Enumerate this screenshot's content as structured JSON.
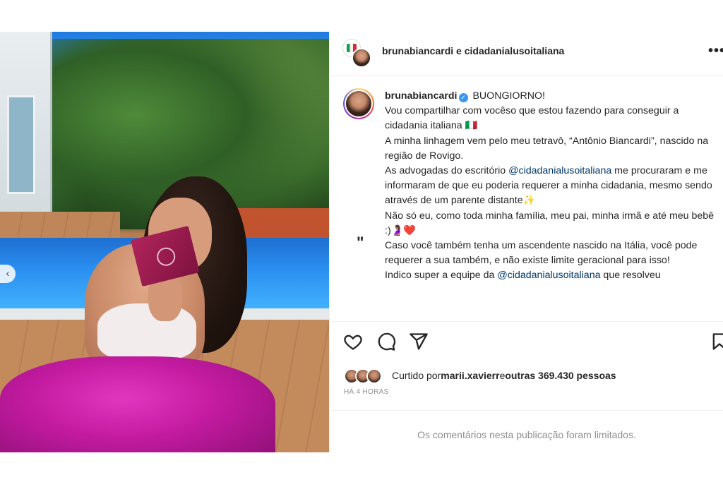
{
  "header": {
    "title_user1": "brunabiancardi",
    "title_conj": " e ",
    "title_user2": "cidadanialusoitaliana",
    "more_icon": "more-horizontal-icon",
    "more_glyph": "•••"
  },
  "post": {
    "carousel_prev_glyph": "‹",
    "carousel_dots": 3,
    "carousel_active": 2
  },
  "caption": {
    "username": "brunabiancardi",
    "verified_glyph": "✓",
    "greeting": "BUONGIORNO!",
    "p1": "Vou compartilhar com vocêso que estou fazendo para conseguir a cidadania italiana 🇮🇹",
    "p2": "A minha linhagem vem pelo meu tetravô, “Antônio Biancardi”, nascido na região de Rovigo.",
    "p3_before": "As advogadas do escritório ",
    "p3_mention": "@cidadanialusoitaliana",
    "p3_after": " me procuraram e me informaram de que eu poderia requerer a minha cidadania, mesmo sendo através de um parente distante✨",
    "quote_mark": "\"",
    "p4": "Não só eu, como toda minha família, meu pai, minha irmã e até meu bebê :)🤰🏽❤️",
    "p5": "Caso você também tenha um ascendente nascido na Itália, você pode requerer a sua também, e não existe limite geracional para isso!",
    "p6_before": "Indico super a equipe da ",
    "p6_mention": "@cidadanialusoitaliana",
    "p6_after": " que resolveu"
  },
  "actions": {
    "like_icon": "heart-icon",
    "comment_icon": "comment-icon",
    "share_icon": "share-icon",
    "save_icon": "bookmark-icon"
  },
  "likes": {
    "prefix": "Curtido por ",
    "user": "marii.xavierr",
    "middle": " e ",
    "others": "outras 369.430 pessoas"
  },
  "timestamp": "HÁ 4 HORAS",
  "comments_limited": "Os comentários nesta publicação foram limitados.",
  "colors": {
    "mention": "#00376b",
    "verified": "#3897f0",
    "muted": "#8e8e8e",
    "text": "#262626"
  }
}
